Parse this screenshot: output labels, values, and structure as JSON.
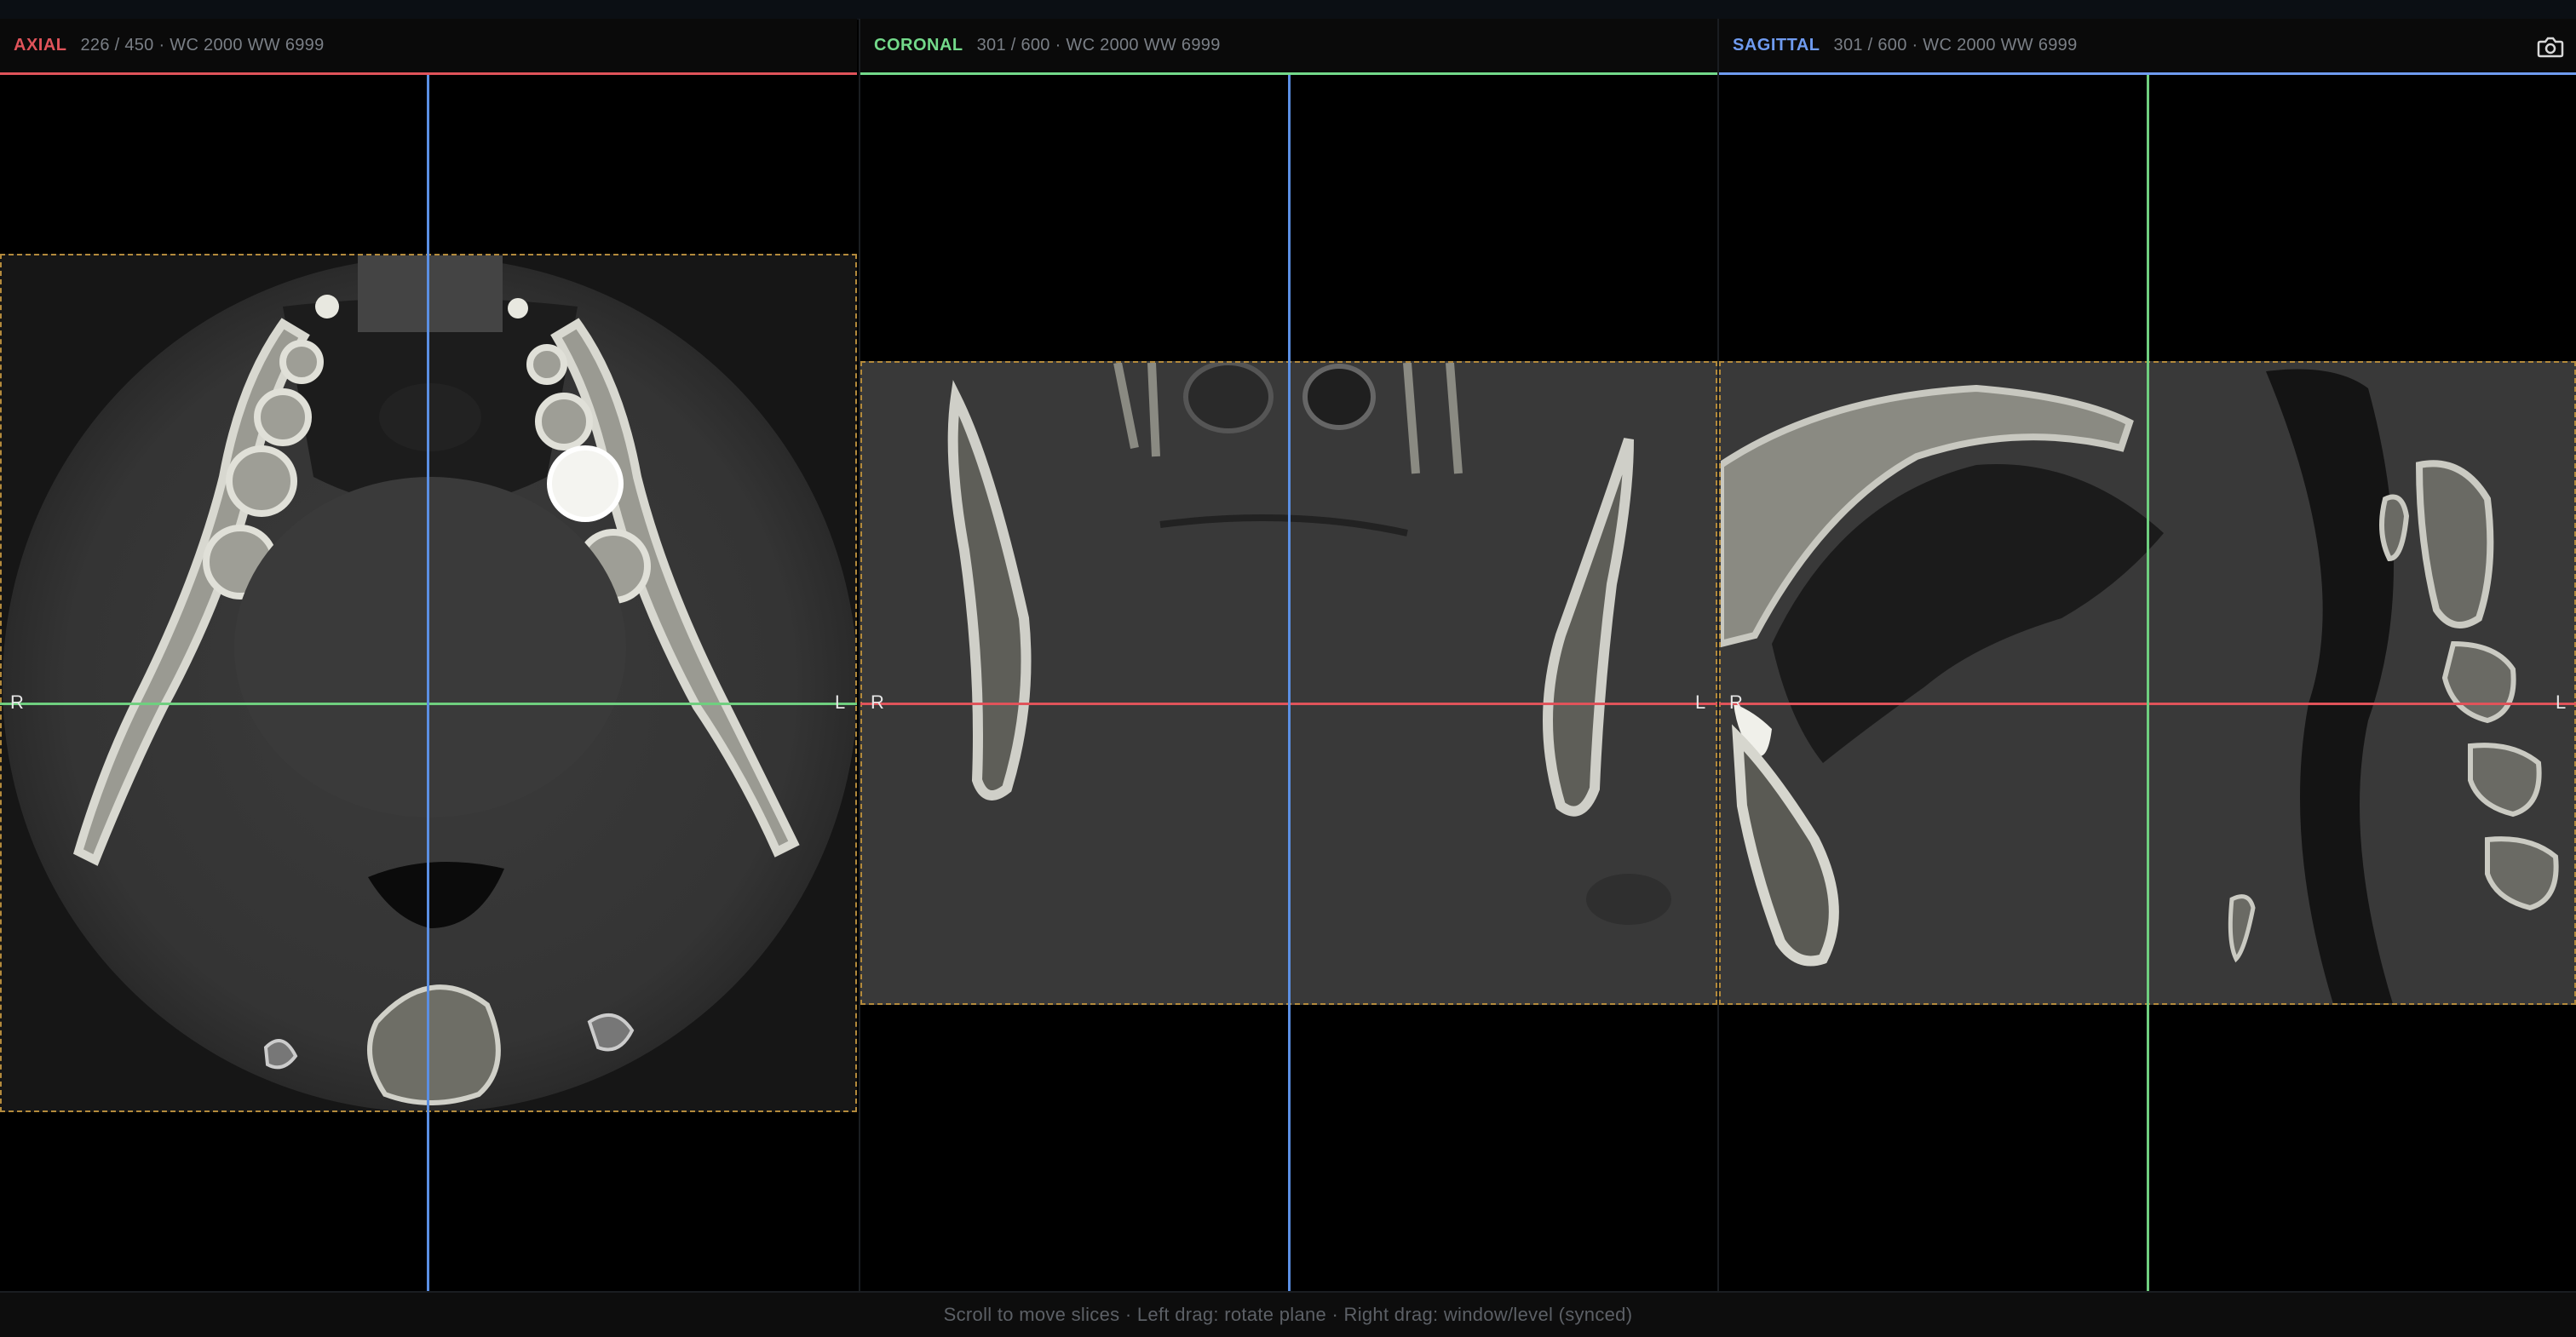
{
  "viewports": [
    {
      "title": "AXIAL",
      "info": "226 / 450 · WC 2000 WW 6999",
      "accent": "#e0535a",
      "orientation_left": "R",
      "orientation_right": "L",
      "crosshair_h_color": "#6fcf7f",
      "crosshair_v_color": "#5b8fe3"
    },
    {
      "title": "CORONAL",
      "info": "301 / 600 · WC 2000 WW 6999",
      "accent": "#73d98a",
      "orientation_left": "R",
      "orientation_right": "L",
      "crosshair_h_color": "#e0535a",
      "crosshair_v_color": "#5b8fe3"
    },
    {
      "title": "SAGITTAL",
      "info": "301 / 600 · WC 2000 WW 6999",
      "accent": "#6f9bf0",
      "orientation_left": "R",
      "orientation_right": "L",
      "crosshair_h_color": "#e0535a",
      "crosshair_v_color": "#6fcf7f"
    }
  ],
  "toolbar": {
    "camera_icon": "camera-icon"
  },
  "colors": {
    "frame_border": "#b38a3c",
    "background": "#000000",
    "bone": "#d8d8d0",
    "soft_tissue": "#3c3c3c"
  },
  "statusbar": {
    "hint": "Scroll to move slices · Left drag: rotate plane · Right drag: window/level (synced)"
  }
}
